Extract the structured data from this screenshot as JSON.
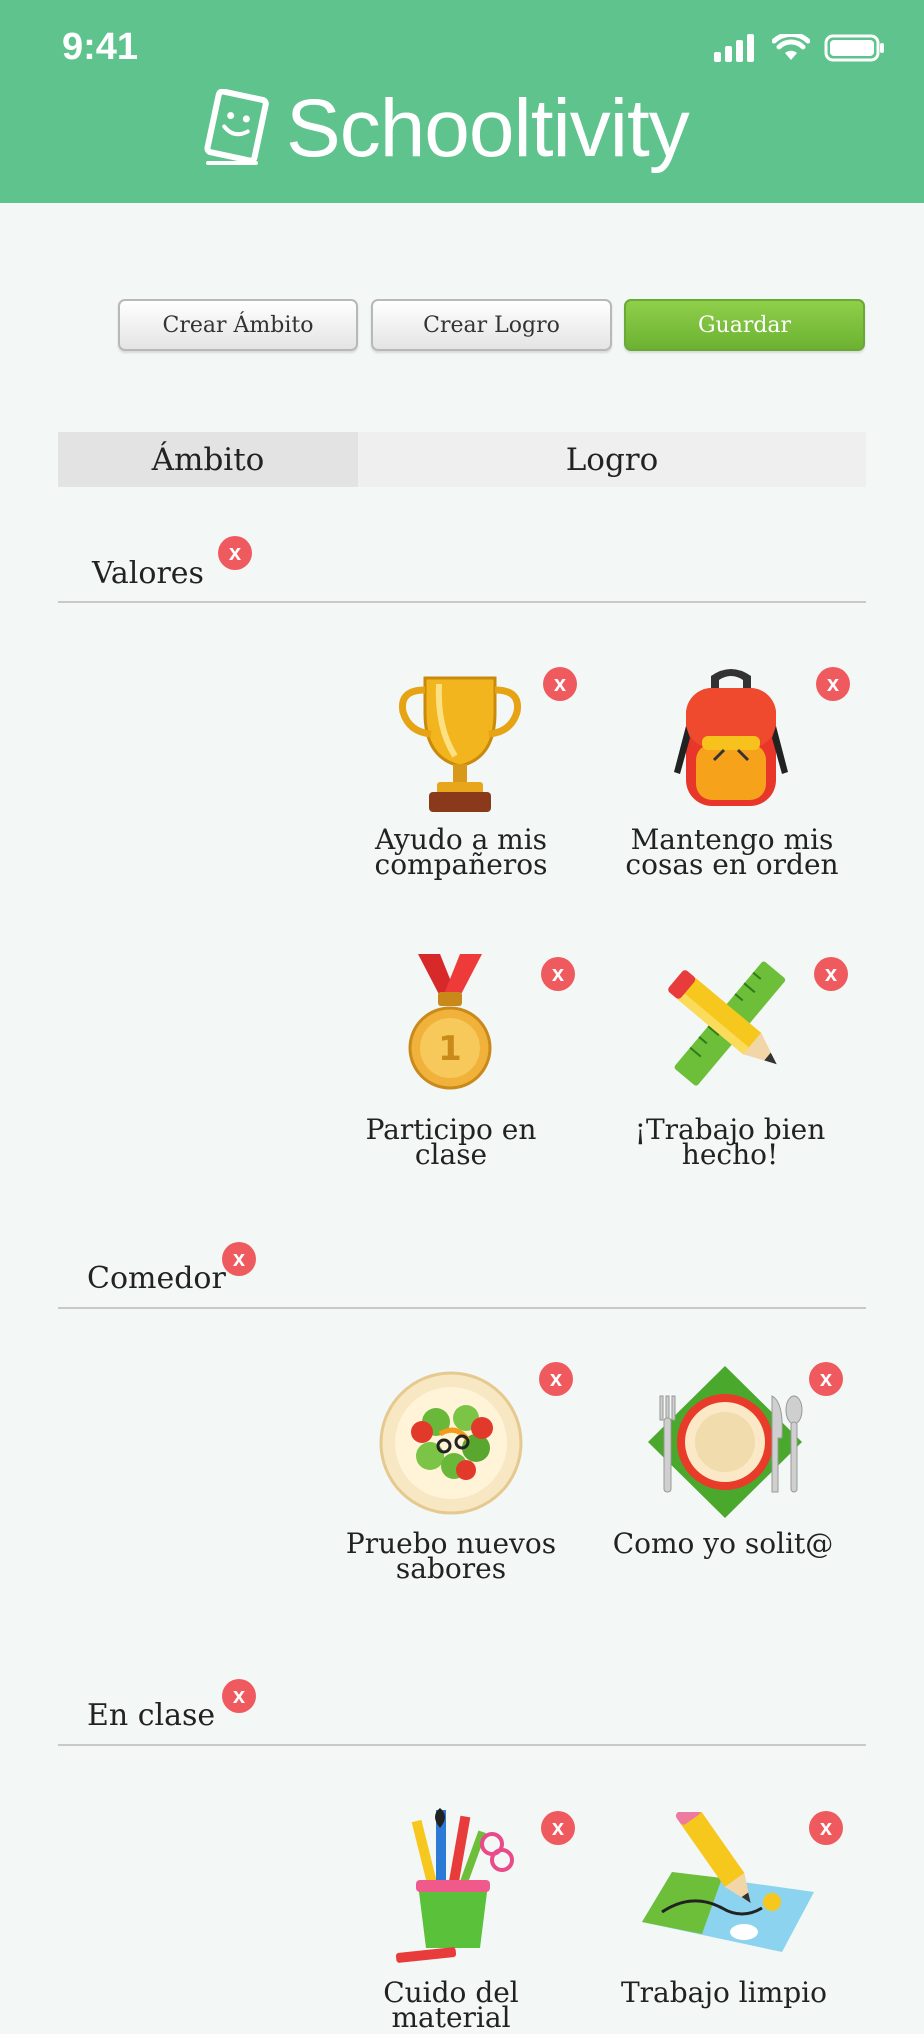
{
  "status_bar": {
    "time": "9:41"
  },
  "header": {
    "app_name": "Schooltivity"
  },
  "toolbar": {
    "create_scope_label": "Crear Ámbito",
    "create_achievement_label": "Crear Logro",
    "save_label": "Guardar"
  },
  "tabs": [
    {
      "label": "Ámbito",
      "active": true
    },
    {
      "label": "Logro",
      "active": false
    }
  ],
  "delete_label": "x",
  "sections": [
    {
      "title": "Valores",
      "items": [
        {
          "label_line1": "Ayudo a mis",
          "label_line2": "compañeros",
          "icon": "trophy-icon"
        },
        {
          "label_line1": "Mantengo mis",
          "label_line2": "cosas en orden",
          "icon": "backpack-icon"
        },
        {
          "label_line1": "Participo en",
          "label_line2": "clase",
          "icon": "medal-icon"
        },
        {
          "label_line1": "¡Trabajo bien",
          "label_line2": "hecho!",
          "icon": "pencil-ruler-icon"
        }
      ]
    },
    {
      "title": "Comedor",
      "items": [
        {
          "label_line1": "Pruebo nuevos",
          "label_line2": "sabores",
          "icon": "salad-icon"
        },
        {
          "label_line1": "Como yo solit@",
          "label_line2": "",
          "icon": "plate-cutlery-icon"
        }
      ]
    },
    {
      "title": "En clase",
      "items": [
        {
          "label_line1": "Cuido del material",
          "label_line2": "",
          "icon": "art-supplies-icon"
        },
        {
          "label_line1": "Trabajo limpio",
          "label_line2": "",
          "icon": "pencil-map-icon"
        }
      ]
    }
  ],
  "colors": {
    "header": "#5ec38d",
    "save": "#7bc23e",
    "delete": "#ef5a5f"
  }
}
